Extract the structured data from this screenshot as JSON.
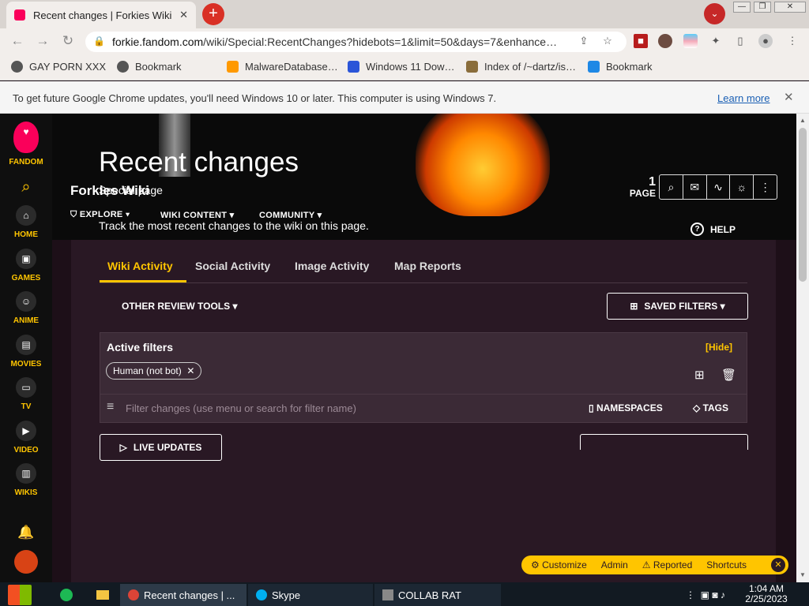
{
  "browser": {
    "tab_title": "Recent changes | Forkies Wiki",
    "tab_close": "✕",
    "new_tab": "+",
    "url_domain": "forkie.fandom.com",
    "url_path": "/wiki/Special:RecentChanges?hidebots=1&limit=50&days=7&enhance…",
    "window_buttons": [
      "—",
      "❐",
      "✕"
    ]
  },
  "bookmarks": [
    {
      "label": "GAY PORN XXX",
      "color": "#444"
    },
    {
      "label": "Bookmark",
      "color": "#444"
    },
    {
      "label": "MalwareDatabase…",
      "color": "#ff9900"
    },
    {
      "label": "Windows 11 Dow…",
      "color": "#2b55d8"
    },
    {
      "label": "Index of /~dartz/is…",
      "color": "#8a6d3b"
    },
    {
      "label": "Bookmark",
      "color": "#1e88e5"
    }
  ],
  "infobar": {
    "message": "To get future Google Chrome updates, you'll need Windows 10 or later. This computer is using Windows 7.",
    "learn_more": "Learn more",
    "close": "✕"
  },
  "rail": [
    {
      "label": "FANDOM",
      "icon": "fandom-heart-icon"
    },
    {
      "label": "",
      "icon": "search-icon"
    },
    {
      "label": "HOME",
      "icon": "home-icon"
    },
    {
      "label": "GAMES",
      "icon": "controller-icon"
    },
    {
      "label": "ANIME",
      "icon": "anime-icon"
    },
    {
      "label": "MOVIES",
      "icon": "clapper-icon"
    },
    {
      "label": "TV",
      "icon": "tv-icon"
    },
    {
      "label": "VIDEO",
      "icon": "video-icon"
    },
    {
      "label": "WIKIS",
      "icon": "book-icon"
    }
  ],
  "wiki": {
    "name": "Forkies Wiki",
    "nav": [
      "EXPLORE",
      "WIKI CONTENT",
      "COMMUNITY"
    ],
    "page_count": "1",
    "page_label": "PAGE"
  },
  "main": {
    "title": "Recent changes",
    "subtitle": "Special page",
    "description": "Track the most recent changes to the wiki on this page.",
    "help": "HELP",
    "tabs": [
      "Wiki Activity",
      "Social Activity",
      "Image Activity",
      "Map Reports"
    ],
    "other_tools": "OTHER REVIEW TOOLS",
    "saved_filters": "SAVED FILTERS",
    "active_filters": "Active filters",
    "hide": "[Hide]",
    "chip": "Human (not bot)",
    "filter_placeholder": "Filter changes (use menu or search for filter name)",
    "namespaces": "NAMESPACES",
    "tags": "TAGS",
    "live_updates": "LIVE UPDATES"
  },
  "admin_bar": [
    "Customize",
    "Admin",
    "Reported",
    "Shortcuts"
  ],
  "taskbar": {
    "items": [
      "Recent changes | ...",
      "Skype",
      "COLLAB RAT"
    ],
    "time": "1:04 AM",
    "date": "2/25/2023"
  },
  "colors": {
    "accent": "#ffc500",
    "brand": "#fa005a"
  }
}
